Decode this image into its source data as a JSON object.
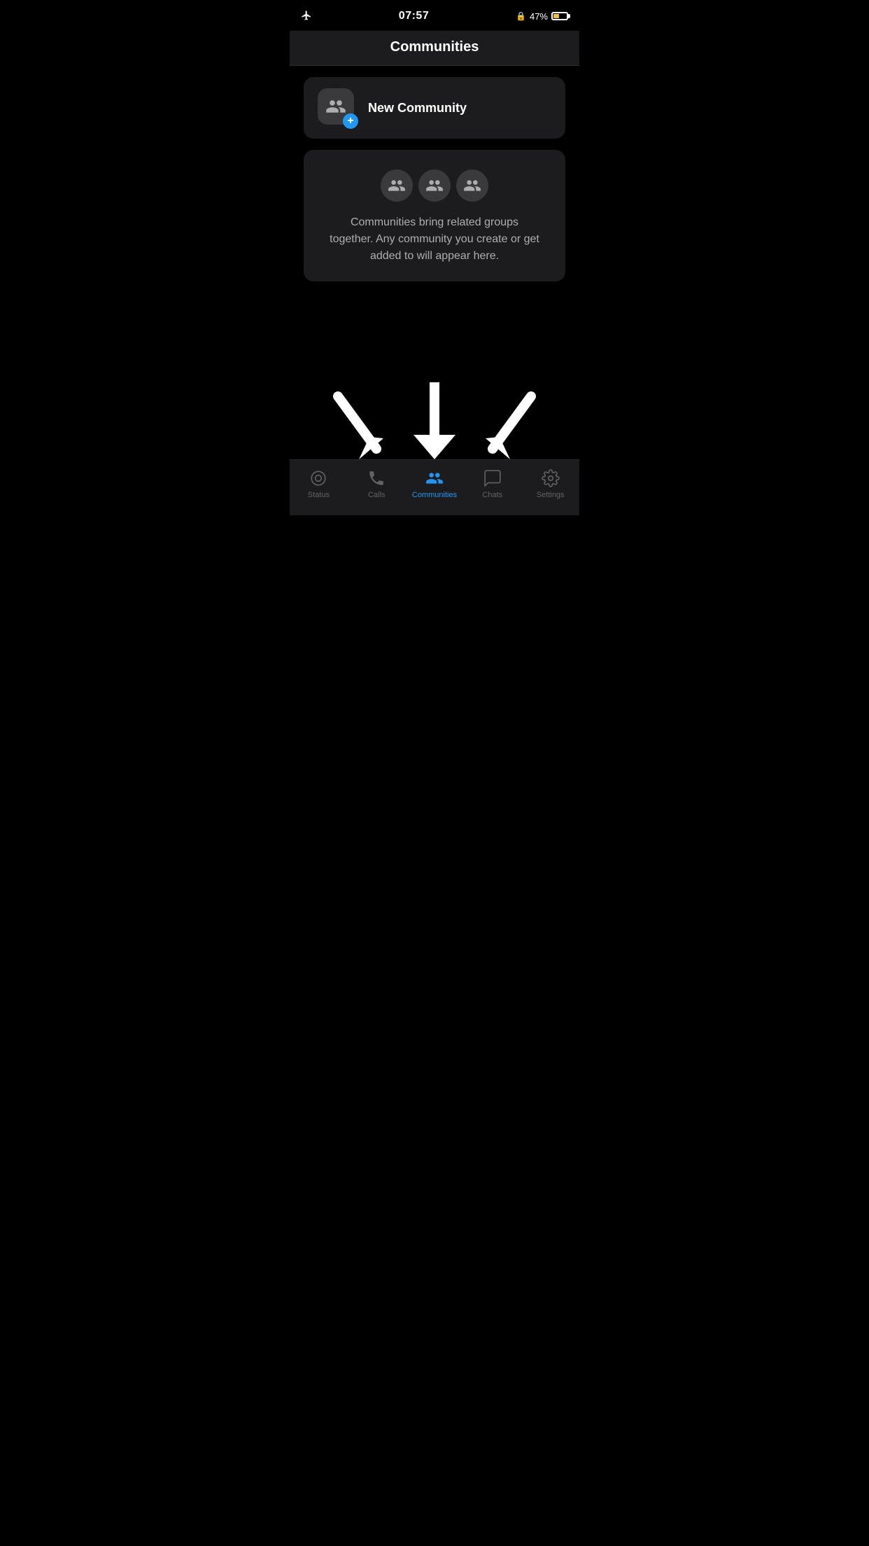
{
  "statusBar": {
    "time": "07:57",
    "batteryPercent": "47%",
    "showAirplane": true
  },
  "header": {
    "title": "Communities"
  },
  "newCommunity": {
    "label": "New Community"
  },
  "infoCard": {
    "text": "Communities bring related groups together. Any community you create or get added to will appear here."
  },
  "tabBar": {
    "items": [
      {
        "id": "status",
        "label": "Status",
        "icon": "status-icon",
        "active": false
      },
      {
        "id": "calls",
        "label": "Calls",
        "icon": "calls-icon",
        "active": false
      },
      {
        "id": "communities",
        "label": "Communities",
        "icon": "communities-icon",
        "active": true
      },
      {
        "id": "chats",
        "label": "Chats",
        "icon": "chats-icon",
        "active": false
      },
      {
        "id": "settings",
        "label": "Settings",
        "icon": "settings-icon",
        "active": false
      }
    ]
  }
}
